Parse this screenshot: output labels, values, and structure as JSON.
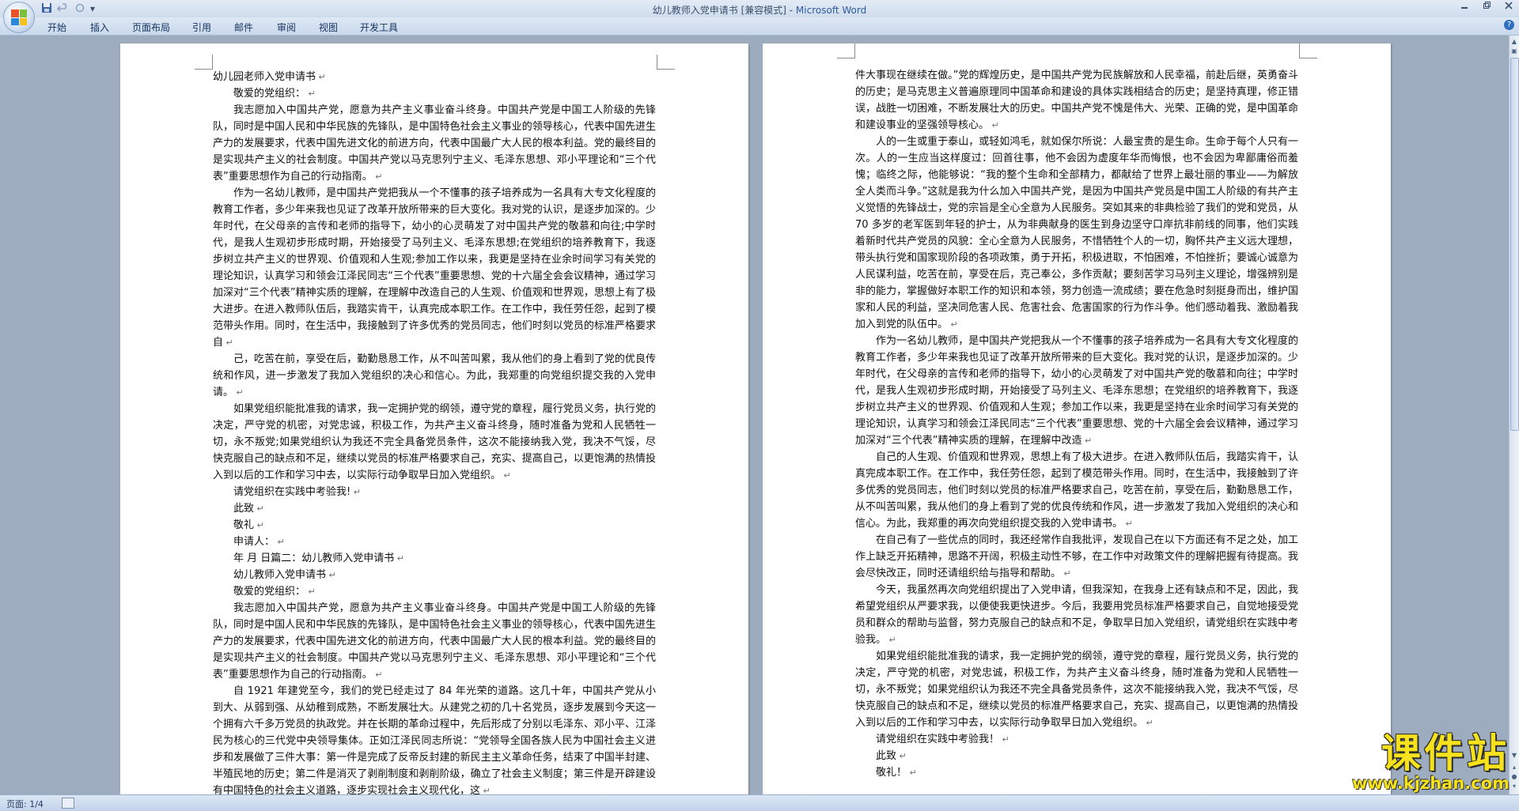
{
  "window": {
    "title_doc": "幼儿教师入党申请书 [兼容模式] - ",
    "title_app": "Microsoft Word"
  },
  "quick_access": {
    "dropdown_glyph": "▾"
  },
  "ribbon_tabs": [
    "开始",
    "插入",
    "页面布局",
    "引用",
    "邮件",
    "审阅",
    "视图",
    "开发工具"
  ],
  "status": {
    "page": "页面: 1/4"
  },
  "watermark": {
    "text": "课件站",
    "url": "www.kjzhan.com"
  },
  "left_page": [
    {
      "t": "幼儿园老师入党申请书",
      "indent": false
    },
    {
      "t": "敬爱的党组织：",
      "indent": true
    },
    {
      "t": "我志愿加入中国共产党，愿意为共产主义事业奋斗终身。中国共产党是中国工人阶级的先锋队，同时是中国人民和中华民族的先锋队，是中国特色社会主义事业的领导核心，代表中国先进生产力的发展要求，代表中国先进文化的前进方向，代表中国最广大人民的根本利益。党的最终目的是实现共产主义的社会制度。中国共产党以马克思列宁主义、毛泽东思想、邓小平理论和“三个代表”重要思想作为自己的行动指南。",
      "indent": true
    },
    {
      "t": "作为一名幼儿教师，是中国共产党把我从一个不懂事的孩子培养成为一名具有大专文化程度的教育工作者，多少年来我也见证了改革开放所带来的巨大变化。我对党的认识，是逐步加深的。少年时代，在父母亲的言传和老师的指导下，幼小的心灵萌发了对中国共产党的敬慕和向往;中学时代，是我人生观初步形成时期，开始接受了马列主义、毛泽东思想;在党组织的培养教育下，我逐步树立共产主义的世界观、价值观和人生观;参加工作以来，我更是坚持在业余时间学习有关党的理论知识，认真学习和领会江泽民同志“三个代表”重要思想、党的十六届全会会议精神，通过学习加深对“三个代表”精神实质的理解，在理解中改造自己的人生观、价值观和世界观，思想上有了极大进步。在进入教师队伍后，我踏实肯干，认真完成本职工作。在工作中，我任劳任怨，起到了模范带头作用。同时，在生活中，我接触到了许多优秀的党员同志，他们时刻以党员的标准严格要求自",
      "indent": true
    },
    {
      "t": "己，吃苦在前，享受在后，勤勤恳恳工作，从不叫苦叫累，我从他们的身上看到了党的优良传统和作风，进一步激发了我加入党组织的决心和信心。为此，我郑重的向党组织提交我的入党申请。",
      "indent": true
    },
    {
      "t": "如果党组织能批准我的请求，我一定拥护党的纲领，遵守党的章程，履行党员义务，执行党的决定，严守党的机密，对党忠诚，积极工作，为共产主义奋斗终身，随时准备为党和人民牺牲一切，永不叛党;如果党组织认为我还不完全具备党员条件，这次不能接纳我入党，我决不气馁，尽快克服自己的缺点和不足，继续以党员的标准严格要求自己，充实、提高自己，以更饱满的热情投入到以后的工作和学习中去，以实际行动争取早日加入党组织。",
      "indent": true
    },
    {
      "t": "请党组织在实践中考验我!",
      "indent": true
    },
    {
      "t": "此致",
      "indent": true
    },
    {
      "t": "敬礼",
      "indent": true
    },
    {
      "t": "申请人：",
      "indent": true
    },
    {
      "t": "年   月   日篇二：幼儿教师入党申请书",
      "indent": true
    },
    {
      "t": "幼儿教师入党申请书",
      "indent": true
    },
    {
      "t": "敬爱的党组织：",
      "indent": true
    },
    {
      "t": "我志愿加入中国共产党，愿意为共产主义事业奋斗终身。中国共产党是中国工人阶级的先锋队，同时是中国人民和中华民族的先锋队，是中国特色社会主义事业的领导核心，代表中国先进生产力的发展要求，代表中国先进文化的前进方向，代表中国最广大人民的根本利益。党的最终目的是实现共产主义的社会制度。中国共产党以马克思列宁主义、毛泽东思想、邓小平理论和“三个代表”重要思想作为自己的行动指南。",
      "indent": true
    },
    {
      "t": "自 1921 年建党至今，我们的党已经走过了 84 年光荣的道路。这几十年，中国共产党从小到大、从弱到强、从幼稚到成熟，不断发展壮大。从建党之初的几十名党员，逐步发展到今天这一个拥有六千多万党员的执政党。并在长期的革命过程中，先后形成了分别以毛泽东、邓小平、江泽民为核心的三代党中央领导集体。正如江泽民同志所说：“党领导全国各族人民为中国社会主义进步和发展做了三件大事：第一件是完成了反帝反封建的新民主主义革命任务，结束了中国半封建、半殖民地的历史；第二件是消灭了剥削制度和剥削阶级，确立了社会主义制度；第三件是开辟建设有中国特色的社会主义道路，逐步实现社会主义现代化，这",
      "indent": true
    }
  ],
  "right_page": [
    {
      "t": "件大事现在继续在做。”党的辉煌历史，是中国共产党为民族解放和人民幸福，前赴后继，英勇奋斗的历史；是马克思主义普遍原理同中国革命和建设的具体实践相结合的历史；是坚持真理，修正错误，战胜一切困难，不断发展壮大的历史。中国共产党不愧是伟大、光荣、正确的党，是中国革命和建设事业的坚强领导核心。",
      "indent": false
    },
    {
      "t": "人的一生或重于泰山，或轻如鸿毛，就如保尔所说：人最宝贵的是生命。生命于每个人只有一次。人的一生应当这样度过：回首往事，他不会因为虚度年华而悔恨，也不会因为卑鄙庸俗而羞愧；临终之际，他能够说：“我的整个生命和全部精力，都献给了世界上最壮丽的事业——为解放全人类而斗争。”这就是我为什么加入中国共产党，是因为中国共产党员是中国工人阶级的有共产主义觉悟的先锋战士，党的宗旨是全心全意为人民服务。突如其来的非典检验了我们的党和党员，从 70 多岁的老军医到年轻的护士，从为非典献身的医生到身边坚守口岸抗非前线的同事，他们实践着新时代共产党员的风貌：全心全意为人民服务，不惜牺牲个人的一切，胸怀共产主义远大理想，带头执行党和国家现阶段的各项政策，勇于开拓，积极进取，不怕困难，不怕挫折；要诚心诚意为人民谋利益，吃苦在前，享受在后，克己奉公，多作贡献；要刻苦学习马列主义理论，增强辨别是非的能力，掌握做好本职工作的知识和本领，努力创造一流成绩；要在危急时刻挺身而出，维护国家和人民的利益，坚决同危害人民、危害社会、危害国家的行为作斗争。他们感动着我、激励着我加入到党的队伍中。",
      "indent": true
    },
    {
      "t": "作为一名幼儿教师，是中国共产党把我从一个不懂事的孩子培养成为一名具有大专文化程度的教育工作者，多少年来我也见证了改革开放所带来的巨大变化。我对党的认识，是逐步加深的。少年时代，在父母亲的言传和老师的指导下，幼小的心灵萌发了对中国共产党的敬慕和向往；中学时代，是我人生观初步形成时期，开始接受了马列主义、毛泽东思想；在党组织的培养教育下，我逐步树立共产主义的世界观、价值观和人生观；参加工作以来，我更是坚持在业余时间学习有关党的理论知识，认真学习和领会江泽民同志“三个代表”重要思想、党的十六届全会会议精神，通过学习加深对“三个代表”精神实质的理解，在理解中改造",
      "indent": true
    },
    {
      "t": "自己的人生观、价值观和世界观，思想上有了极大进步。在进入教师队伍后，我踏实肯干，认真完成本职工作。在工作中，我任劳任怨，起到了模范带头作用。同时，在生活中，我接触到了许多优秀的党员同志，他们时刻以党员的标准严格要求自己，吃苦在前，享受在后，勤勤恳恳工作，从不叫苦叫累，我从他们的身上看到了党的优良传统和作风，进一步激发了我加入党组织的决心和信心。为此，我郑重的再次向党组织提交我的入党申请书。",
      "indent": true
    },
    {
      "t": "在自己有了一些优点的同时，我还经常作自我批评，发现自己在以下方面还有不足之处，加工作上缺乏开拓精神，思路不开阔，积极主动性不够，在工作中对政策文件的理解把握有待提高。我会尽快改正，同时还请组织给与指导和帮助。",
      "indent": true
    },
    {
      "t": "今天，我虽然再次向党组织提出了入党申请，但我深知，在我身上还有缺点和不足，因此，我希望党组织从严要求我，以便使我更快进步。今后，我要用党员标准严格要求自己，自觉地接受党员和群众的帮助与监督，努力克服自己的缺点和不足，争取早日加入党组织，请党组织在实践中考验我。",
      "indent": true
    },
    {
      "t": "如果党组织能批准我的请求，我一定拥护党的纲领，遵守党的章程，履行党员义务，执行党的决定，严守党的机密，对党忠诚，积极工作，为共产主义奋斗终身，随时准备为党和人民牺牲一切，永不叛党；如果党组织认为我还不完全具备党员条件，这次不能接纳我入党，我决不气馁，尽快克服自己的缺点和不足，继续以党员的标准严格要求自己，充实、提高自己，以更饱满的热情投入到以后的工作和学习中去，以实际行动争取早日加入党组织。",
      "indent": true
    },
    {
      "t": "请党组织在实践中考验我！",
      "indent": true
    },
    {
      "t": "此致",
      "indent": true
    },
    {
      "t": "敬礼！",
      "indent": true
    }
  ]
}
